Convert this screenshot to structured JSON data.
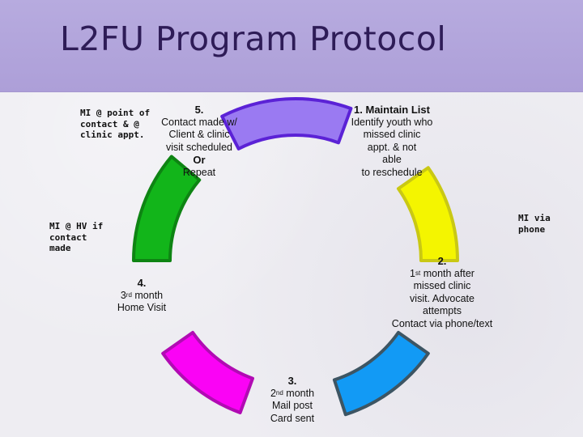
{
  "title": "L2FU Program Protocol",
  "colors": {
    "header": "#b2a5dc",
    "title": "#2e1c57",
    "background": "#eeedf2"
  },
  "segments": [
    {
      "id": "purple",
      "step": "1",
      "fill": "#9a7af2",
      "stroke": "#5b22d6"
    },
    {
      "id": "yellow",
      "step": "2",
      "fill": "#f4f500",
      "stroke": "#c9c814"
    },
    {
      "id": "blue",
      "step": "3",
      "fill": "#129af5",
      "stroke": "#3d5563"
    },
    {
      "id": "magenta",
      "step": "4",
      "fill": "#fa03f5",
      "stroke": "#b10bb3"
    },
    {
      "id": "green",
      "step": "5",
      "fill": "#12b51a",
      "stroke": "#0e8413"
    }
  ],
  "steps": {
    "step1": {
      "heading": "1. Maintain List",
      "lines": [
        "Identify youth who",
        "missed clinic",
        "appt. & not",
        "able",
        "to reschedule"
      ]
    },
    "step2": {
      "heading": "2.",
      "line1_sup": "st",
      "line1_pre": "1",
      "line1_post": " month after",
      "lines": [
        "missed clinic",
        "visit. Advocate",
        "attempts",
        "Contact via phone/text"
      ]
    },
    "step3": {
      "heading": "3.",
      "line1_pre": "2",
      "line1_sup": "nd",
      "line1_post": " month",
      "lines": [
        "Mail post",
        "Card sent"
      ]
    },
    "step4": {
      "heading": "4.",
      "line1_pre": "3",
      "line1_sup": "rd",
      "line1_post": " month",
      "lines": [
        "Home Visit"
      ]
    },
    "step5": {
      "heading": "5.",
      "lines": [
        "Contact made w/",
        "Client & clinic",
        "visit scheduled"
      ],
      "or": "Or",
      "last": "Repeat"
    }
  },
  "mi_notes": {
    "clinic": [
      "MI @ point of",
      "contact & @",
      "clinic appt."
    ],
    "hv": [
      "MI @ HV if",
      "contact",
      "made"
    ],
    "phone": [
      "MI via",
      "phone"
    ]
  }
}
